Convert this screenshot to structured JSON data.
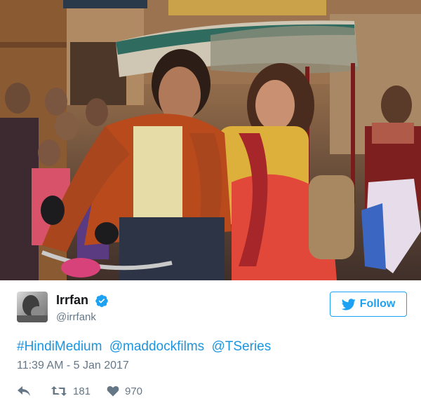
{
  "tweet": {
    "display_name": "Irrfan",
    "handle": "@irrfank",
    "verified_icon": "verified-badge-icon",
    "follow_label": "Follow",
    "text_parts": [
      "#HindiMedium",
      "@maddockfilms",
      "@TSeries"
    ],
    "timestamp": "11:39 AM - 5 Jan 2017",
    "retweet_count": "181",
    "like_count": "970"
  },
  "colors": {
    "link": "#1b95e0",
    "twitter_blue": "#1da1f2",
    "muted": "#657786",
    "text": "#14171a"
  },
  "icons": {
    "reply": "reply-icon",
    "retweet": "retweet-icon",
    "like": "heart-icon",
    "follow": "twitter-bird-icon"
  }
}
